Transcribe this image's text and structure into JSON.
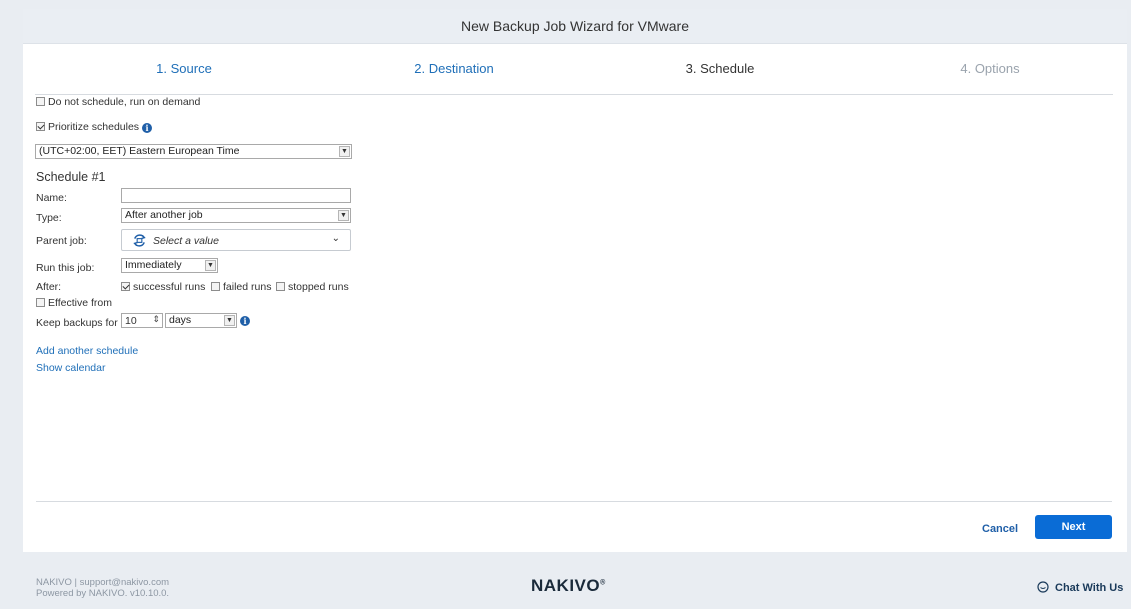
{
  "wizard": {
    "title": "New Backup Job Wizard for VMware",
    "steps": [
      {
        "label": "1. Source"
      },
      {
        "label": "2. Destination"
      },
      {
        "label": "3. Schedule"
      },
      {
        "label": "4. Options"
      }
    ]
  },
  "schedule_page": {
    "do_not_schedule_label": "Do not schedule, run on demand",
    "do_not_schedule_checked": false,
    "prioritize_label": "Prioritize schedules",
    "prioritize_checked": true,
    "timezone_value": "(UTC+02:00, EET) Eastern European Time",
    "schedule_title": "Schedule #1",
    "name_label": "Name:",
    "name_value": "",
    "type_label": "Type:",
    "type_value": "After another job",
    "parent_job_label": "Parent job:",
    "parent_job_placeholder": "Select a value",
    "run_label": "Run this job:",
    "run_value": "Immediately",
    "after_label": "After:",
    "after_options": [
      {
        "label": "successful runs",
        "checked": true
      },
      {
        "label": "failed runs",
        "checked": false
      },
      {
        "label": "stopped runs",
        "checked": false
      }
    ],
    "effective_from_label": "Effective from",
    "effective_from_checked": false,
    "keep_label": "Keep backups for",
    "keep_value": "10",
    "keep_unit": "days",
    "add_schedule_link": "Add another schedule",
    "show_calendar_link": "Show calendar"
  },
  "buttons": {
    "cancel": "Cancel",
    "next": "Next"
  },
  "footer": {
    "line1": "NAKIVO | support@nakivo.com",
    "line2": "Powered by NAKIVO. v10.10.0.",
    "logo": "NAKIVO",
    "logo_mark": "®",
    "chat": "Chat With Us"
  },
  "colors": {
    "accent": "#0a6cd6",
    "link": "#1f6fb8",
    "background": "#e9edf2"
  }
}
